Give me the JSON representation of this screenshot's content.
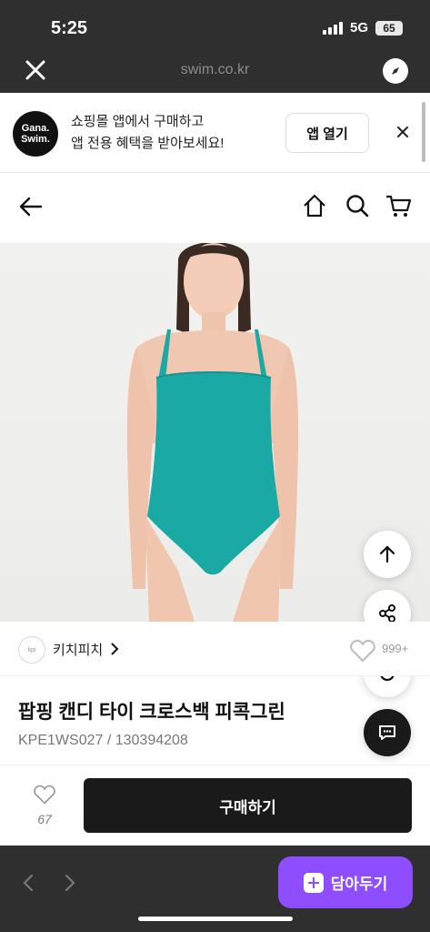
{
  "status": {
    "time": "5:25",
    "network": "5G",
    "battery": "65"
  },
  "browser": {
    "url": "swim.co.kr"
  },
  "app_banner": {
    "logo_line1": "Gana.",
    "logo_line2": "Swim.",
    "text_line1": "쇼핑몰 앱에서 구매하고",
    "text_line2": "앱 전용 혜택을 받아보세요!",
    "open_label": "앱 열기"
  },
  "brand": {
    "logo_text": "kpi",
    "name": "키치피치",
    "likes": "999+"
  },
  "product": {
    "title": "팝핑 캔디 타이 크로스백 피콕그린",
    "code": "KPE1WS027 / 130394208",
    "swimsuit_color": "#1aa9a4"
  },
  "purchase": {
    "wish_count": "67",
    "buy_label": "구매하기"
  },
  "bottom": {
    "save_label": "담아두기",
    "accent": "#8e4dff"
  },
  "icons": {
    "close": "close-icon",
    "compass": "compass-icon",
    "back": "arrow-left-icon",
    "home": "home-icon",
    "search": "search-icon",
    "cart": "cart-icon",
    "scroll_top": "arrow-up-icon",
    "share": "share-icon",
    "refresh": "refresh-icon",
    "chat": "chat-icon",
    "heart": "heart-icon"
  }
}
